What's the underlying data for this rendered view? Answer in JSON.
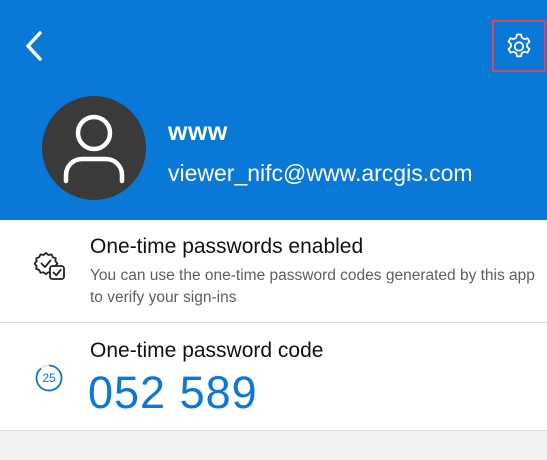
{
  "header": {
    "back_icon": "chevron-left-icon",
    "settings_icon": "gear-icon",
    "highlight_color": "#d9475a",
    "background_color": "#0a78d7"
  },
  "account": {
    "name": "www",
    "email": "viewer_nifc@www.arcgis.com",
    "avatar_icon": "person-icon"
  },
  "otp_status": {
    "icon": "check-badge-icon",
    "title": "One-time passwords enabled",
    "description": "You can use the one-time password codes generated by this app to verify your sign-ins"
  },
  "otp_code": {
    "label": "One-time password code",
    "code": "052 589",
    "seconds_remaining": "25",
    "timer_icon": "countdown-ring-icon"
  }
}
